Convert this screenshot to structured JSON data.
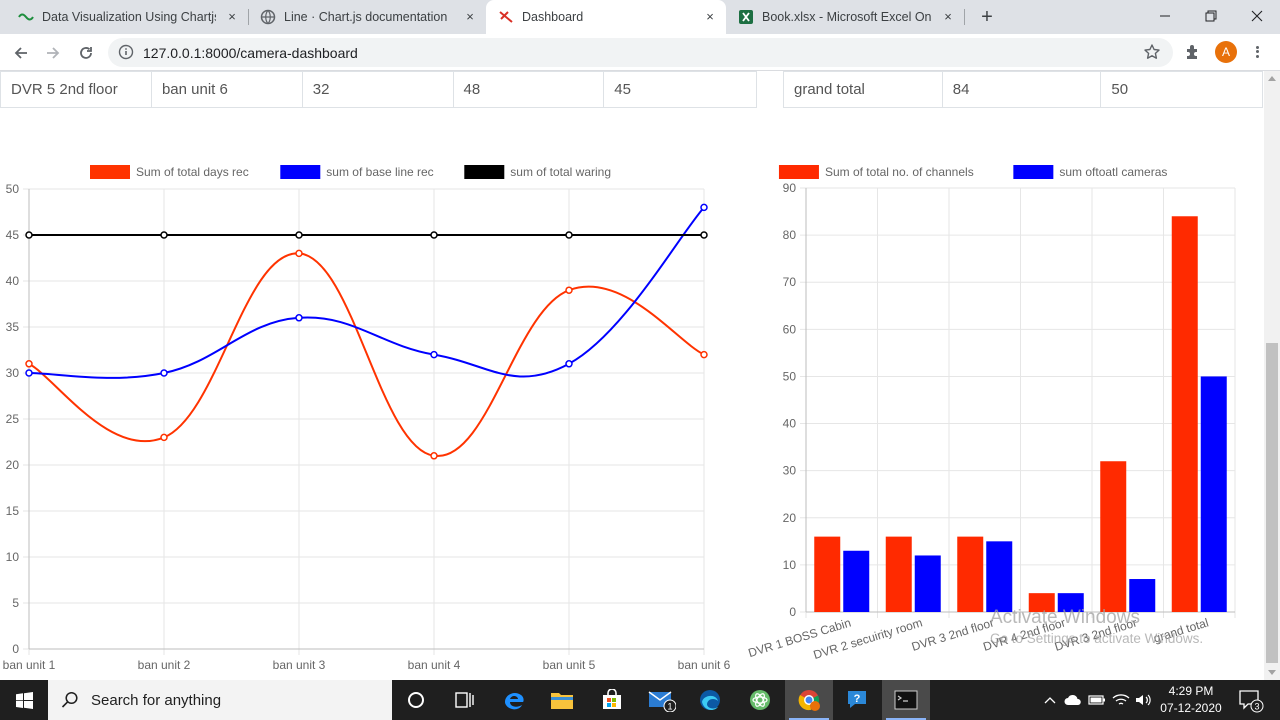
{
  "browser": {
    "tabs": [
      {
        "title": "Data Visualization Using Chartjs and",
        "active": false
      },
      {
        "title": "Line · Chart.js documentation",
        "active": false
      },
      {
        "title": "Dashboard",
        "active": true
      },
      {
        "title": "Book.xlsx - Microsoft Excel Online",
        "active": false
      }
    ],
    "close_glyph": "×",
    "new_tab_glyph": "+",
    "url": "127.0.0.1:8000/camera-dashboard",
    "avatar_letter": "A"
  },
  "page": {
    "table_left": {
      "rows": [
        [
          "DVR 5 2nd floor",
          "ban unit 6",
          "32",
          "48",
          "45"
        ]
      ]
    },
    "table_right": {
      "rows": [
        [
          "grand total",
          "84",
          "50"
        ]
      ]
    }
  },
  "chart_data": [
    {
      "type": "line",
      "categories": [
        "ban unit 1",
        "ban unit 2",
        "ban unit 3",
        "ban unit 4",
        "ban unit 5",
        "ban unit 6"
      ],
      "series": [
        {
          "name": "Sum of total days rec",
          "color": "#ff3300",
          "values": [
            31,
            23,
            43,
            21,
            39,
            32
          ]
        },
        {
          "name": "sum of base line rec",
          "color": "#0000ff",
          "values": [
            30,
            30,
            36,
            32,
            31,
            48
          ]
        },
        {
          "name": "sum of total waring",
          "color": "#000000",
          "values": [
            45,
            45,
            45,
            45,
            45,
            45
          ]
        }
      ],
      "ylim": [
        0,
        50
      ],
      "yticks": [
        0,
        5,
        10,
        15,
        20,
        25,
        30,
        35,
        40,
        45,
        50
      ],
      "grid": true,
      "legend": "top-center"
    },
    {
      "type": "bar",
      "categories": [
        "DVR 1 BOSS Cabin",
        "DVR 2 secuirity room",
        "DVR 3 2nd floor",
        "DVR 4 2nd floor",
        "DVR 3 2nd floor",
        "grand total"
      ],
      "series": [
        {
          "name": "Sum of total no. of channels",
          "color": "#ff2a00",
          "values": [
            16,
            16,
            16,
            4,
            32,
            84
          ]
        },
        {
          "name": "sum oftoatl cameras",
          "color": "#0000ff",
          "values": [
            13,
            12,
            15,
            4,
            7,
            50
          ]
        }
      ],
      "ylim": [
        0,
        90
      ],
      "yticks": [
        0,
        10,
        20,
        30,
        40,
        50,
        60,
        70,
        80,
        90
      ],
      "grid": true,
      "legend": "top-center"
    }
  ],
  "watermark": {
    "line1": "Activate Windows",
    "line2": "Go to Settings to activate Windows."
  },
  "taskbar": {
    "search_placeholder": "Search for anything",
    "mail_badge": "1",
    "time": "4:29 PM",
    "date": "07-12-2020",
    "notification_count": "3"
  }
}
